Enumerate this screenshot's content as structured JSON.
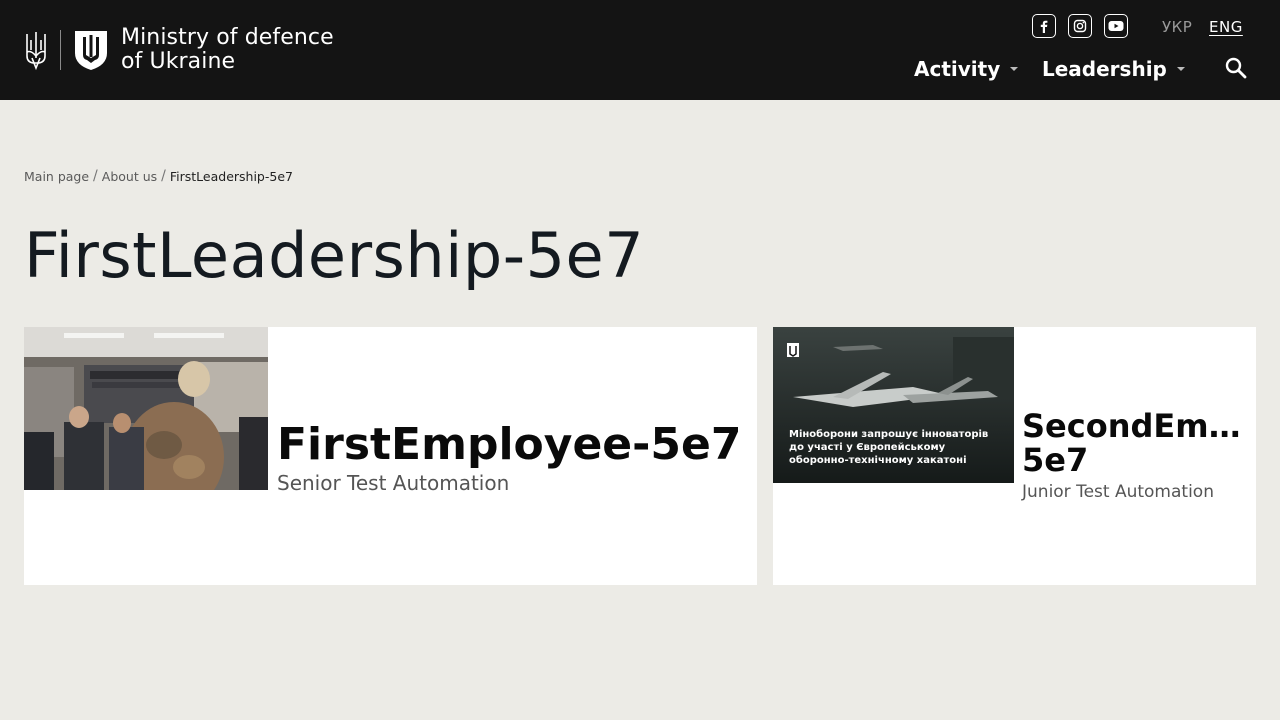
{
  "header": {
    "logo_line1": "Ministry of defence",
    "logo_line2": "of Ukraine",
    "socials": [
      "facebook-icon",
      "instagram-icon",
      "youtube-icon"
    ],
    "lang_ukr": "УКР",
    "lang_eng": "ENG",
    "nav": {
      "activity": "Activity",
      "leadership": "Leadership"
    },
    "colors": {
      "background": "#141414",
      "text": "#ffffff"
    }
  },
  "breadcrumb": {
    "items": [
      "Main page",
      "About us"
    ],
    "current": "FirstLeadership-5e7",
    "separator": "/"
  },
  "page": {
    "title": "FirstLeadership-5e7",
    "background": "#ecebe6"
  },
  "cards": [
    {
      "name": "FirstEmployee-5e7",
      "role": "Senior Test Automation"
    },
    {
      "name_line1": "SecondEmpl…",
      "name_line2": "5e7",
      "role": "Junior Test Automation",
      "image_caption": [
        "Міноборони запрошує інноваторів",
        "до участі у Європейському",
        "оборонно-технічному хакатоні"
      ]
    }
  ]
}
